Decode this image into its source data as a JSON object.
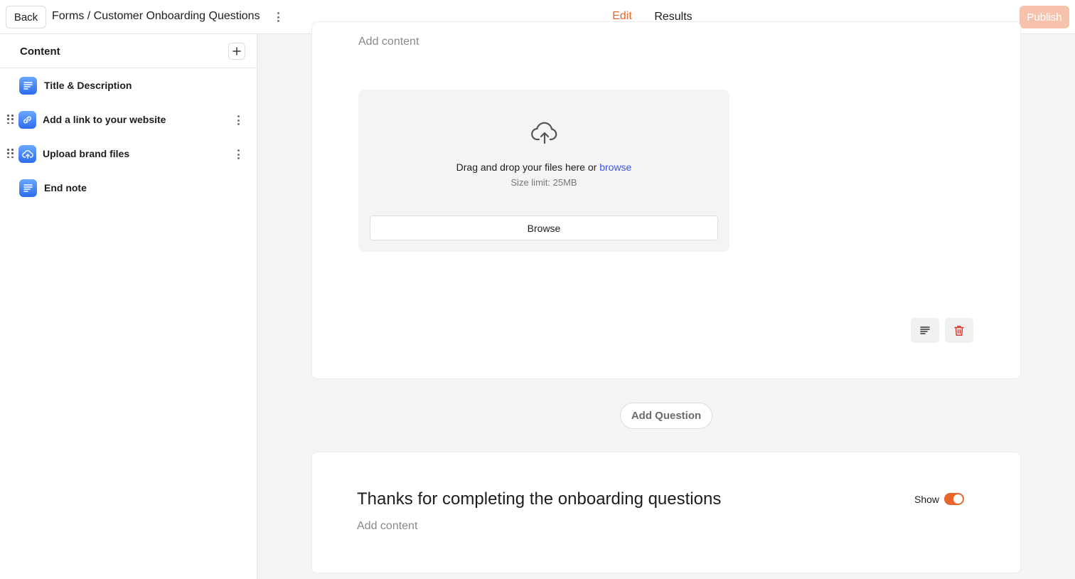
{
  "header": {
    "back_label": "Back",
    "breadcrumb": "Forms / Customer Onboarding Questions",
    "tabs": [
      {
        "label": "Edit",
        "active": true
      },
      {
        "label": "Results",
        "active": false
      }
    ],
    "publish_label": "Publish"
  },
  "sidebar": {
    "title": "Content",
    "items": [
      {
        "label": "Title & Description",
        "icon": "text-lines-icon"
      },
      {
        "label": "Add a link to your website",
        "icon": "link-icon"
      },
      {
        "label": "Upload brand files",
        "icon": "cloud-upload-icon"
      },
      {
        "label": "End note",
        "icon": "text-lines-icon"
      }
    ]
  },
  "upload_card": {
    "add_content": "Add content",
    "drop_text": "Drag and drop your files here or",
    "drop_link": "browse",
    "size_limit": "Size limit: 25MB",
    "browse_label": "Browse"
  },
  "add_question_label": "Add Question",
  "end_card": {
    "title": "Thanks for completing the onboarding questions",
    "add_content": "Add content",
    "show_label": "Show",
    "show_enabled": true
  },
  "colors": {
    "accent": "#e8662e",
    "publish_disabled": "#f6c2ab",
    "link": "#3b55e6",
    "icon_blue": "#2d6cf0",
    "delete_red": "#d93a2b"
  }
}
